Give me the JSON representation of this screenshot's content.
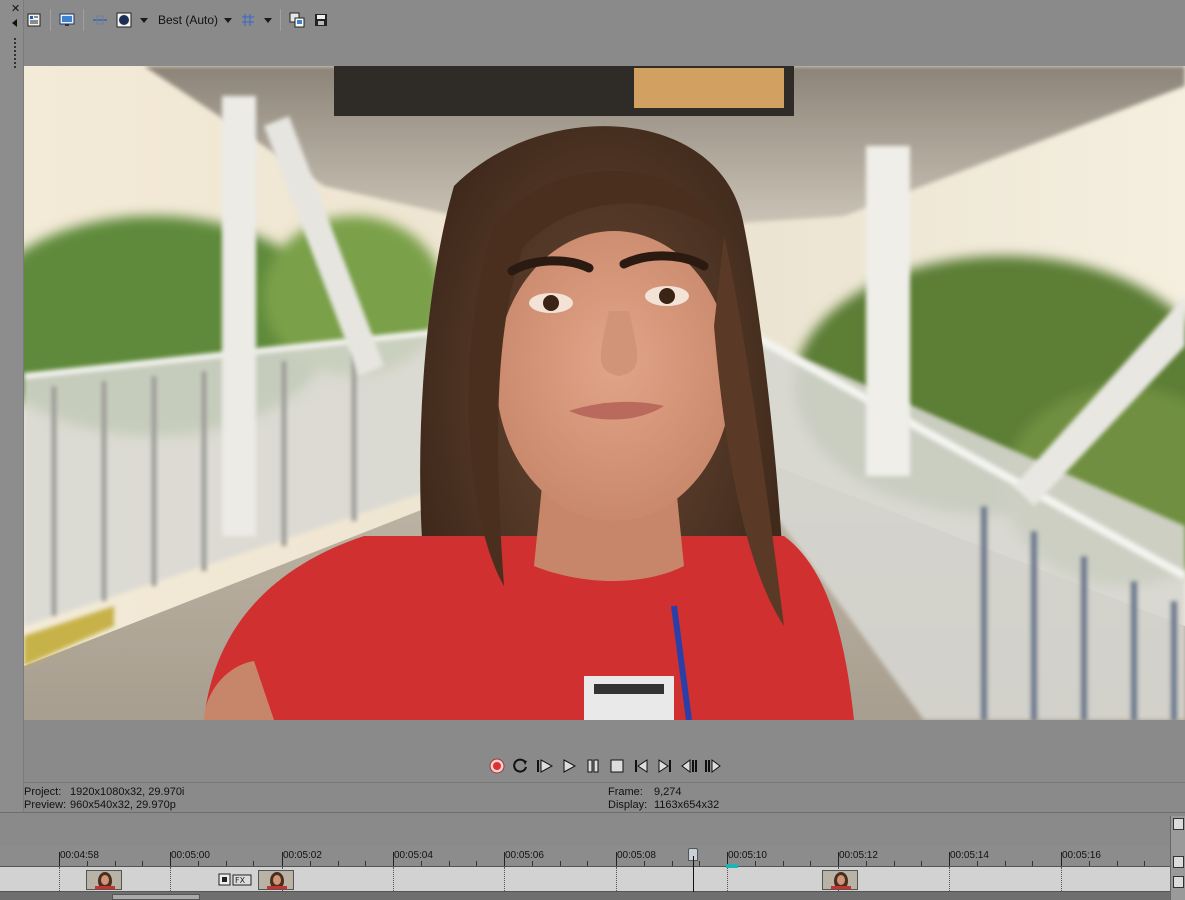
{
  "toolbar": {
    "quality_label": "Best (Auto)",
    "buttons": [
      "preview-properties-icon",
      "external-monitor-icon",
      "split-screen-icon",
      "overlay-icon",
      "grid-icon",
      "copy-snapshot-icon",
      "save-snapshot-icon"
    ]
  },
  "preview": {
    "subject": "video-frame"
  },
  "transport": {
    "buttons": [
      "record-icon",
      "loop-icon",
      "play-from-start-icon",
      "play-icon",
      "pause-icon",
      "stop-icon",
      "previous-frame-icon",
      "next-frame-icon",
      "step-back-icon",
      "step-forward-icon"
    ],
    "colors": {
      "record": "#e03030"
    }
  },
  "info": {
    "project_label": "Project:",
    "project_value": "1920x1080x32, 29.970i",
    "preview_label": "Preview:",
    "preview_value": "960x540x32, 29.970p",
    "frame_label": "Frame:",
    "frame_value": "9,274",
    "display_label": "Display:",
    "display_value": "1163x654x32"
  },
  "timeline": {
    "ticks": [
      "00:04:58",
      "00:05:00",
      "00:05:02",
      "00:05:04",
      "00:05:06",
      "00:05:08",
      "00:05:10",
      "00:05:12",
      "00:05:14",
      "00:05:16"
    ],
    "marker_color": "#1fb5b5"
  }
}
